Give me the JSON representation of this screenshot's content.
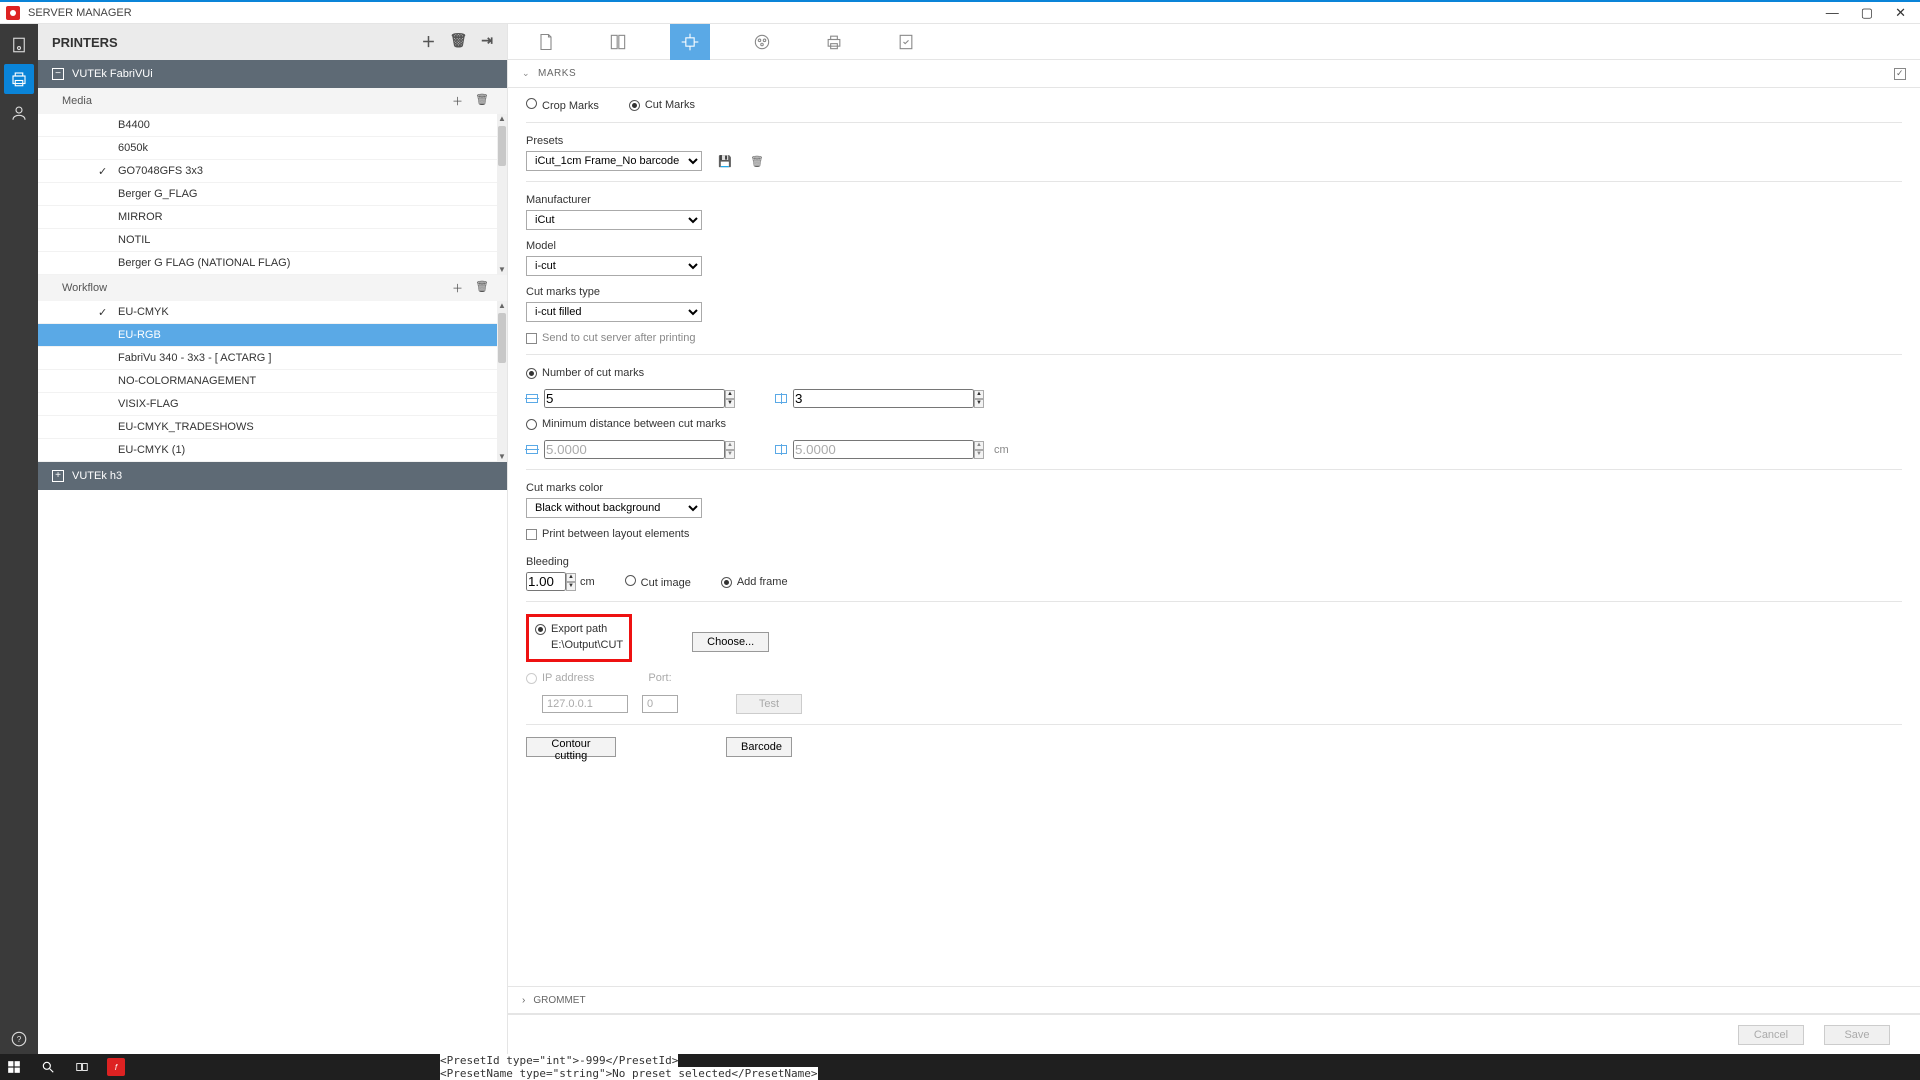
{
  "titlebar": {
    "title": "SERVER MANAGER"
  },
  "sidebar": {
    "header": "PRINTERS",
    "printers": [
      {
        "name": "VUTEk FabriVUi",
        "expanded": true
      },
      {
        "name": "VUTEk h3",
        "expanded": false
      }
    ],
    "media_label": "Media",
    "media_items": [
      {
        "label": "B4400"
      },
      {
        "label": "6050k"
      },
      {
        "label": "GO7048GFS 3x3",
        "checked": true
      },
      {
        "label": "Berger G_FLAG"
      },
      {
        "label": "MIRROR"
      },
      {
        "label": "NOTIL"
      },
      {
        "label": "Berger G  FLAG  (NATIONAL FLAG)"
      }
    ],
    "workflow_label": "Workflow",
    "workflow_items": [
      {
        "label": "EU-CMYK",
        "checked": true
      },
      {
        "label": "EU-RGB",
        "active": true
      },
      {
        "label": "FabriVu 340 - 3x3 - [ ACTARG ]"
      },
      {
        "label": "NO-COLORMANAGEMENT"
      },
      {
        "label": "VISIX-FLAG"
      },
      {
        "label": "EU-CMYK_TRADESHOWS"
      },
      {
        "label": "EU-CMYK  (1)"
      }
    ]
  },
  "main": {
    "section_marks": "MARKS",
    "section_grommet": "GROMMET",
    "crop_marks": "Crop Marks",
    "cut_marks": "Cut Marks",
    "presets_label": "Presets",
    "preset_value": "iCut_1cm Frame_No barcode",
    "manufacturer_label": "Manufacturer",
    "manufacturer_value": "iCut",
    "model_label": "Model",
    "model_value": "i-cut",
    "cut_type_label": "Cut marks type",
    "cut_type_value": "i-cut filled",
    "send_to_server": "Send to cut server after printing",
    "num_marks_label": "Number of cut marks",
    "num_marks_h": "5",
    "num_marks_v": "3",
    "min_dist_label": "Minimum distance between cut marks",
    "min_dist_h": "5.0000",
    "min_dist_v": "5.0000",
    "unit_cm": "cm",
    "color_label": "Cut marks color",
    "color_value": "Black without background",
    "print_between": "Print between layout elements",
    "bleeding_label": "Bleeding",
    "bleeding_value": "1.00",
    "cut_image": "Cut image",
    "add_frame": "Add frame",
    "export_path_label": "Export path",
    "export_path_value": "E:\\Output\\CUT",
    "choose_btn": "Choose...",
    "ip_label": "IP address",
    "ip_value": "127.0.0.1",
    "port_label": "Port:",
    "port_value": "0",
    "test_btn": "Test",
    "contour_btn": "Contour cutting",
    "barcode_btn": "Barcode",
    "cancel_btn": "Cancel",
    "save_btn": "Save"
  },
  "codeview": {
    "line1": "<PresetId type=\"int\">-999</PresetId>",
    "line2": "<PresetName type=\"string\">No preset selected</PresetName>"
  }
}
